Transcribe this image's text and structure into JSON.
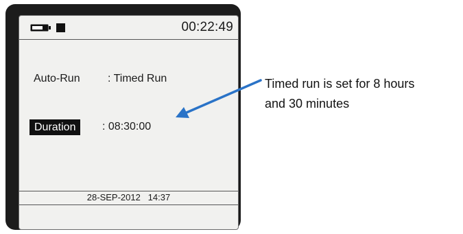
{
  "device": {
    "clock": "00:22:49",
    "battery_icon": "battery-icon",
    "memory_icon": "memory-square-icon",
    "auto_run_label": "Auto-Run",
    "auto_run_value": ": Timed Run",
    "duration_label": "Duration",
    "duration_value": ": 08:30:00",
    "footer_datetime": "28-SEP-2012   14:37"
  },
  "annotation": {
    "line1": "Timed run is set for 8 hours",
    "line2": "and 30 minutes",
    "arrow_color": "#2a73c7"
  }
}
